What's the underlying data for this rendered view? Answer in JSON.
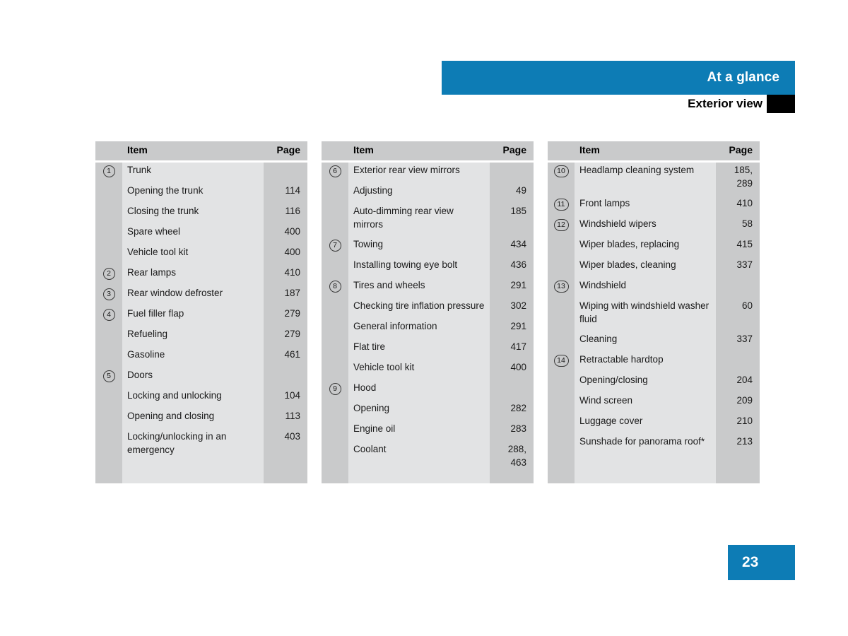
{
  "header": {
    "title": "At a glance",
    "subtitle": "Exterior view",
    "bar_color": "#0d7cb5",
    "block_color": "#000000"
  },
  "page_number": "23",
  "table_headers": {
    "item": "Item",
    "page": "Page"
  },
  "columns": [
    {
      "id": "column-1",
      "rows": [
        {
          "marker": "1",
          "item": "Trunk",
          "page": ""
        },
        {
          "marker": "",
          "item": "Opening the trunk",
          "page": "114"
        },
        {
          "marker": "",
          "item": "Closing the trunk",
          "page": "116"
        },
        {
          "marker": "",
          "item": "Spare wheel",
          "page": "400"
        },
        {
          "marker": "",
          "item": "Vehicle tool kit",
          "page": "400"
        },
        {
          "marker": "2",
          "item": "Rear lamps",
          "page": "410"
        },
        {
          "marker": "3",
          "item": "Rear window defroster",
          "page": "187"
        },
        {
          "marker": "4",
          "item": "Fuel filler flap",
          "page": "279"
        },
        {
          "marker": "",
          "item": "Refueling",
          "page": "279"
        },
        {
          "marker": "",
          "item": "Gasoline",
          "page": "461"
        },
        {
          "marker": "5",
          "item": "Doors",
          "page": ""
        },
        {
          "marker": "",
          "item": "Locking and unlocking",
          "page": "104"
        },
        {
          "marker": "",
          "item": "Opening and closing",
          "page": "113"
        },
        {
          "marker": "",
          "item": "Locking/unlocking in an emergency",
          "page": "403"
        }
      ]
    },
    {
      "id": "column-2",
      "rows": [
        {
          "marker": "6",
          "item": "Exterior rear view mirrors",
          "page": ""
        },
        {
          "marker": "",
          "item": "Adjusting",
          "page": "49"
        },
        {
          "marker": "",
          "item": "Auto-dimming rear view mirrors",
          "page": "185"
        },
        {
          "marker": "7",
          "item": "Towing",
          "page": "434"
        },
        {
          "marker": "",
          "item": "Installing towing eye bolt",
          "page": "436"
        },
        {
          "marker": "8",
          "item": "Tires and wheels",
          "page": "291"
        },
        {
          "marker": "",
          "item": "Checking tire inflation pressure",
          "page": "302"
        },
        {
          "marker": "",
          "item": "General information",
          "page": "291"
        },
        {
          "marker": "",
          "item": "Flat tire",
          "page": "417"
        },
        {
          "marker": "",
          "item": "Vehicle tool kit",
          "page": "400"
        },
        {
          "marker": "9",
          "item": "Hood",
          "page": ""
        },
        {
          "marker": "",
          "item": "Opening",
          "page": "282"
        },
        {
          "marker": "",
          "item": "Engine oil",
          "page": "283"
        },
        {
          "marker": "",
          "item": "Coolant",
          "page": "288,\n463"
        }
      ]
    },
    {
      "id": "column-3",
      "rows": [
        {
          "marker": "10",
          "item": "Headlamp cleaning system",
          "page": "185,\n289"
        },
        {
          "marker": "11",
          "item": "Front lamps",
          "page": "410"
        },
        {
          "marker": "12",
          "item": "Windshield wipers",
          "page": "58"
        },
        {
          "marker": "",
          "item": "Wiper blades, replacing",
          "page": "415"
        },
        {
          "marker": "",
          "item": "Wiper blades, cleaning",
          "page": "337"
        },
        {
          "marker": "13",
          "item": "Windshield",
          "page": ""
        },
        {
          "marker": "",
          "item": "Wiping with windshield washer fluid",
          "page": "60"
        },
        {
          "marker": "",
          "item": "Cleaning",
          "page": "337"
        },
        {
          "marker": "14",
          "item": "Retractable hardtop",
          "page": ""
        },
        {
          "marker": "",
          "item": "Opening/closing",
          "page": "204"
        },
        {
          "marker": "",
          "item": "Wind screen",
          "page": "209"
        },
        {
          "marker": "",
          "item": "Luggage cover",
          "page": "210"
        },
        {
          "marker": "",
          "item": "Sunshade for panorama roof*",
          "page": "213"
        }
      ]
    }
  ]
}
